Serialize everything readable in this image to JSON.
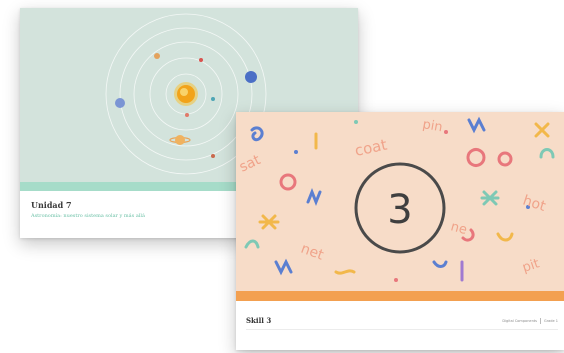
{
  "left_card": {
    "title": "Unidad 7",
    "subtitle": "Astronomía: nuestro sistema solar y más allá",
    "colors": {
      "art_bg": "#d3e3dc",
      "band": "#a6dcc9",
      "subtitle": "#6cc1a7"
    },
    "illustration": "solar-system"
  },
  "right_card": {
    "title": "Skill 3",
    "number": "3",
    "meta_left": "Digital Components",
    "meta_right": "Grade 1",
    "art_words": [
      "coat",
      "pin",
      "sat",
      "hot",
      "net",
      "pit",
      "ne"
    ],
    "colors": {
      "art_bg": "#f7dcc8",
      "band": "#f3a050"
    }
  }
}
